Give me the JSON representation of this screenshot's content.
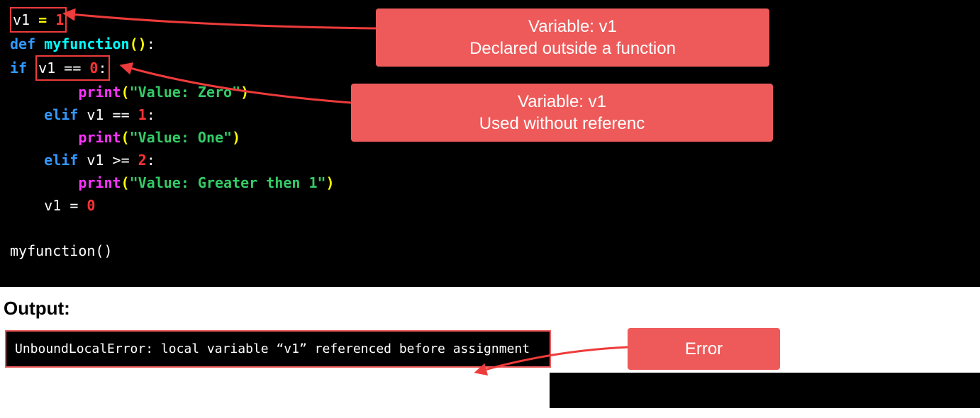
{
  "code": {
    "line1_var": "v1",
    "line1_eq": "=",
    "line1_val": "1",
    "line2_def": "def",
    "line2_fn": "myfunction",
    "line3_if": "if",
    "line3_var": "v1",
    "line3_op": "==",
    "line3_val": "0",
    "line4_print": "print",
    "line4_str": "\"Value: Zero\"",
    "line5_elif": "elif",
    "line5_var": "v1",
    "line5_op": "==",
    "line5_val": "1",
    "line6_print": "print",
    "line6_str": "\"Value: One\"",
    "line7_elif": "elif",
    "line7_var": "v1",
    "line7_op": ">=",
    "line7_val": "2",
    "line8_print": "print",
    "line8_str": "\"Value: Greater then 1\"",
    "line9_var": "v1",
    "line9_eq": "=",
    "line9_val": "0",
    "line10_call": "myfunction()"
  },
  "callouts": {
    "c1_line1": "Variable: v1",
    "c1_line2": "Declared outside a function",
    "c2_line1": "Variable: v1",
    "c2_line2": "Used without referenc",
    "c3_line1": "Error"
  },
  "output": {
    "label": "Output:",
    "text": "UnboundLocalError: local variable “v1” referenced before assignment"
  }
}
